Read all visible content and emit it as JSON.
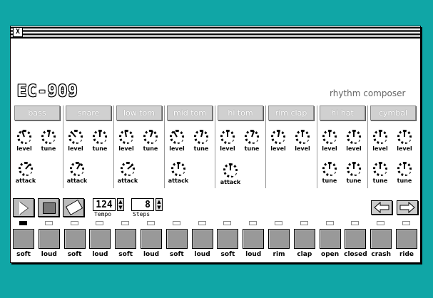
{
  "window": {
    "close_glyph": "X"
  },
  "app": {
    "logo": "EC-909",
    "subtitle": "rhythm composer"
  },
  "instruments": [
    {
      "label": "bass",
      "knobs": [
        "level",
        "tune",
        "attack"
      ]
    },
    {
      "label": "snare",
      "knobs": [
        "level",
        "tune",
        "attack"
      ]
    },
    {
      "label": "low tom",
      "knobs": [
        "level",
        "tune",
        "attack"
      ]
    },
    {
      "label": "mid tom",
      "knobs": [
        "level",
        "tune",
        "attack"
      ]
    },
    {
      "label": "hi tom",
      "knobs": [
        "level",
        "tune",
        "attack"
      ]
    },
    {
      "label": "rim clap",
      "knobs": [
        "level",
        "level"
      ]
    },
    {
      "label": "hi hat",
      "knobs": [
        "level",
        "level",
        "tune",
        "tune"
      ]
    },
    {
      "label": "cymbal",
      "knobs": [
        "level",
        "level",
        "tune",
        "tune"
      ]
    }
  ],
  "transport": {
    "play_icon": "play-icon",
    "stop_icon": "stop-icon",
    "clear_icon": "eraser-icon",
    "tempo_value": "124",
    "tempo_label": "Tempo",
    "steps_value": "8",
    "steps_label": "Steps",
    "prev_icon": "left-arrow-icon",
    "next_icon": "right-arrow-icon"
  },
  "pads": [
    "soft",
    "loud",
    "soft",
    "loud",
    "soft",
    "loud",
    "soft",
    "loud",
    "soft",
    "loud",
    "rim",
    "clap",
    "open",
    "closed",
    "crash",
    "ride"
  ],
  "active_step": 1
}
